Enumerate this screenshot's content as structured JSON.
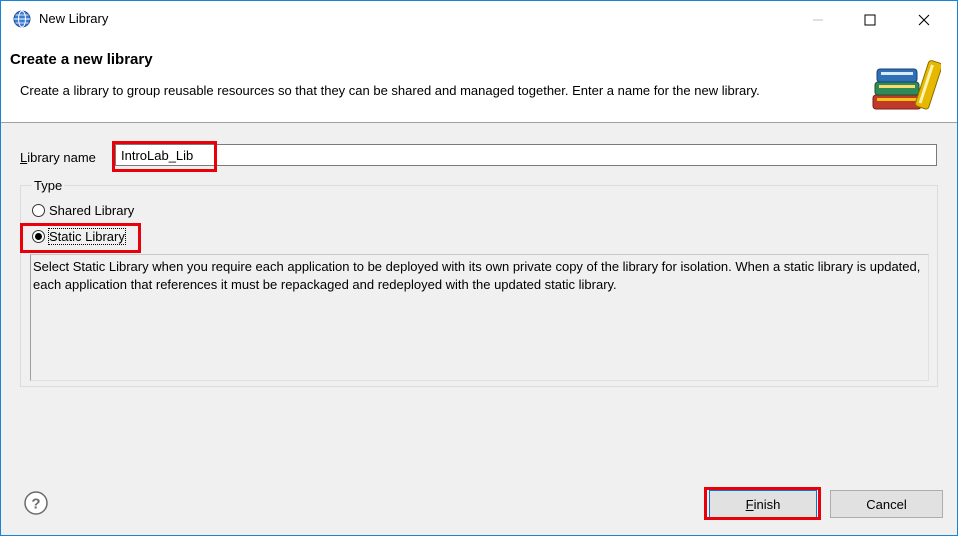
{
  "window": {
    "title": "New Library"
  },
  "header": {
    "title": "Create a new library",
    "description": "Create a library to group reusable resources so that they can be shared and managed together.  Enter a name for the new library."
  },
  "form": {
    "library_name_label_mnemonic": "L",
    "library_name_label_rest": "ibrary name",
    "library_name_value": "IntroLab_Lib",
    "type_group_label": "Type",
    "options": [
      {
        "label": "Shared Library",
        "selected": false
      },
      {
        "label": "Static Library",
        "selected": true
      }
    ],
    "description": "Select Static Library when you require each application to be deployed with its own private copy of the library for isolation.  When a static library is updated, each application that references it must be repackaged and redeployed with the updated static library."
  },
  "buttons": {
    "finish_mnemonic": "F",
    "finish_rest": "inish",
    "cancel": "Cancel"
  },
  "icons": {
    "title": "globe-icon",
    "header": "books-icon",
    "help": "help-icon",
    "minimize": "minimize-icon",
    "maximize": "maximize-icon",
    "close": "close-icon"
  },
  "colors": {
    "highlight": "#e8000b",
    "accent": "#0078d7"
  }
}
